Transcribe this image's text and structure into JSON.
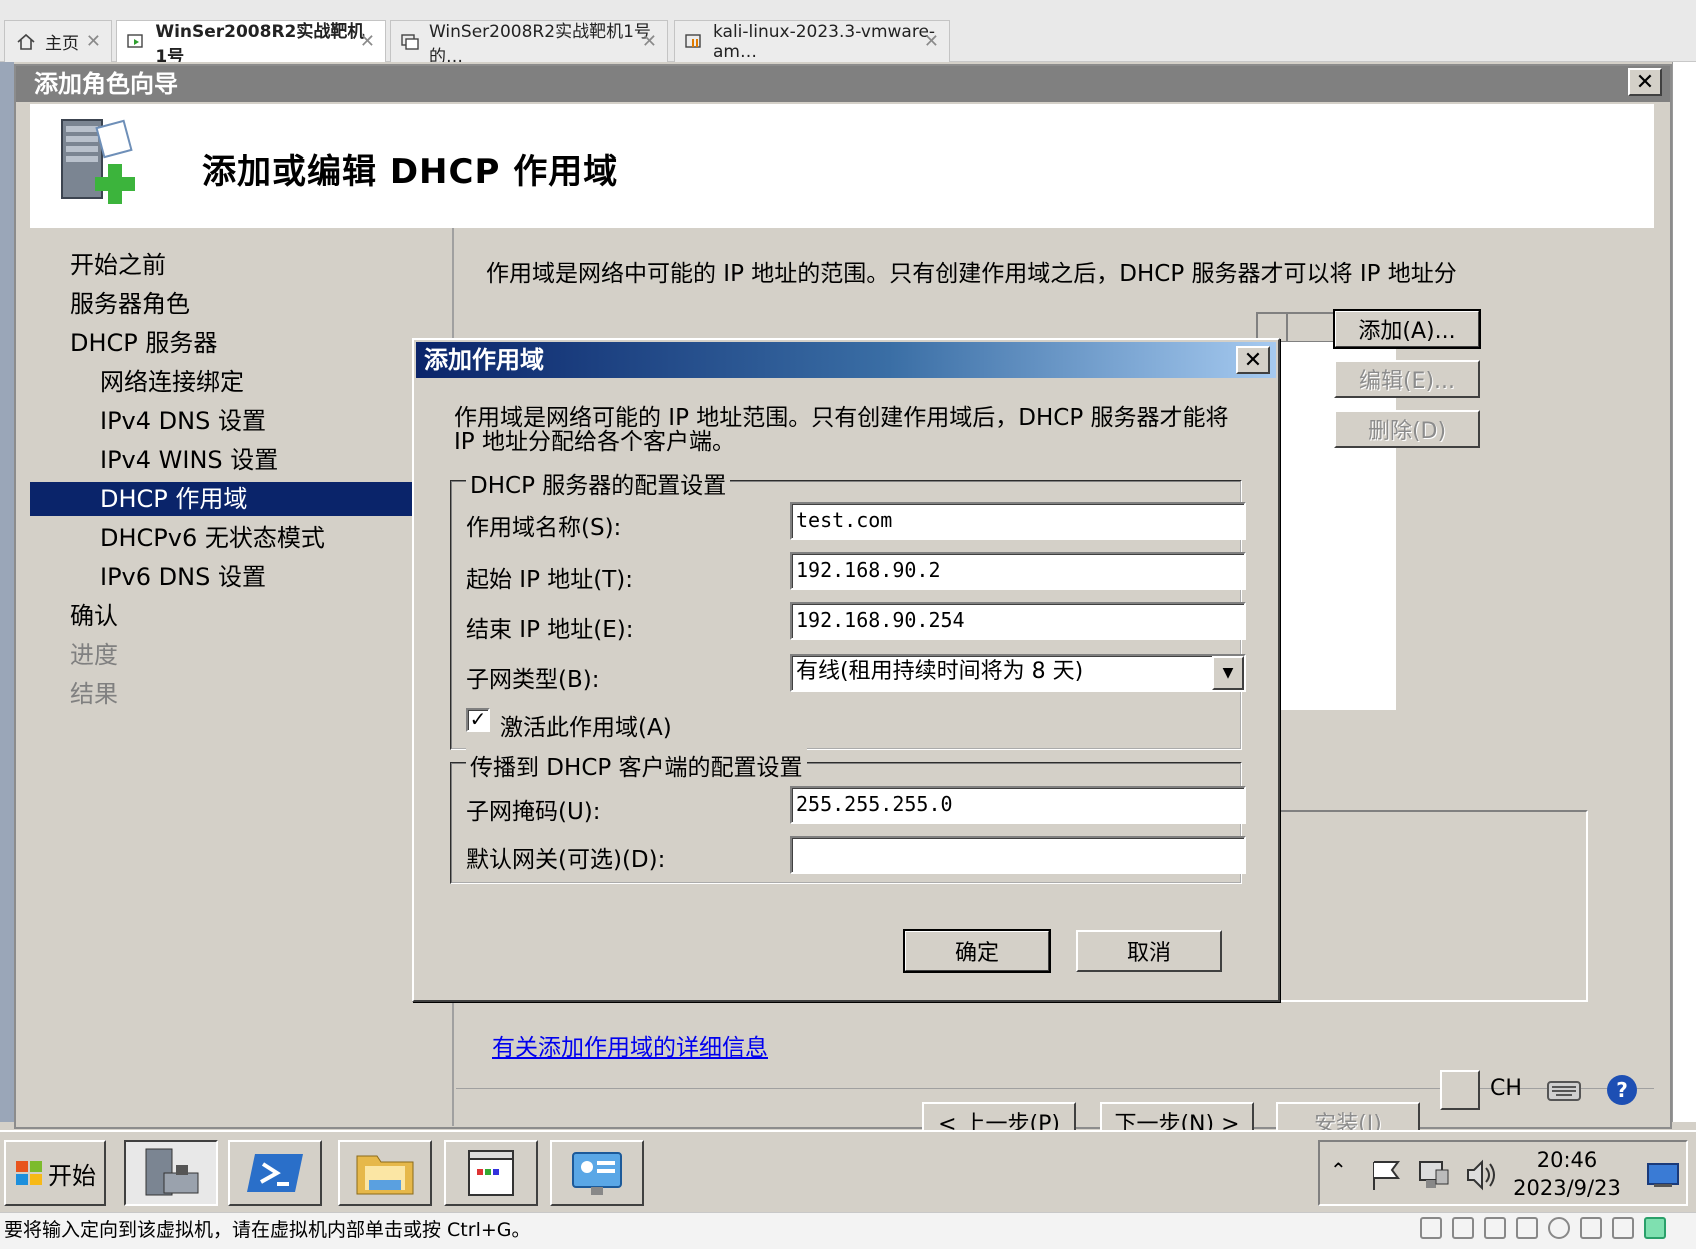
{
  "host": {
    "tabs": [
      {
        "label": "主页",
        "active": false
      },
      {
        "label": "WinSer2008R2实战靶机1号",
        "active": true
      },
      {
        "label": "WinSer2008R2实战靶机1号 的…",
        "active": false
      },
      {
        "label": "kali-linux-2023.3-vmware-am…",
        "active": false
      }
    ],
    "status_text": "要将输入定向到该虚拟机，请在虚拟机内部单击或按 Ctrl+G。"
  },
  "wizard": {
    "window_title": "添加角色向导",
    "page_title": "添加或编辑 DHCP 作用域",
    "nav": [
      {
        "label": "开始之前",
        "level": 1,
        "state": "normal"
      },
      {
        "label": "服务器角色",
        "level": 1,
        "state": "normal"
      },
      {
        "label": "DHCP 服务器",
        "level": 1,
        "state": "normal"
      },
      {
        "label": "网络连接绑定",
        "level": 2,
        "state": "normal"
      },
      {
        "label": "IPv4 DNS 设置",
        "level": 2,
        "state": "normal"
      },
      {
        "label": "IPv4 WINS 设置",
        "level": 2,
        "state": "normal"
      },
      {
        "label": "DHCP 作用域",
        "level": 2,
        "state": "selected"
      },
      {
        "label": "DHCPv6 无状态模式",
        "level": 2,
        "state": "normal"
      },
      {
        "label": "IPv6 DNS 设置",
        "level": 2,
        "state": "normal"
      },
      {
        "label": "确认",
        "level": 1,
        "state": "normal"
      },
      {
        "label": "进度",
        "level": 1,
        "state": "dim"
      },
      {
        "label": "结果",
        "level": 1,
        "state": "dim"
      }
    ],
    "description": "作用域是网络中可能的 IP 地址的范围。只有创建作用域之后，DHCP 服务器才可以将 IP 地址分",
    "add_button": "添加(A)...",
    "edit_button": "编辑(E)...",
    "delete_button": "删除(D)",
    "details_link": "有关添加作用域的详细信息",
    "prev_button": "< 上一步(P)",
    "next_button": "下一步(N) >",
    "install_button": "安装(I)"
  },
  "dialog": {
    "title": "添加作用域",
    "description": "作用域是网络可能的 IP 地址范围。只有创建作用域后，DHCP 服务器才能将 IP 地址分配给各个客户端。",
    "server_group": {
      "label": "DHCP 服务器的配置设置",
      "scope_name_label": "作用域名称(S):",
      "scope_name_value": "test.com",
      "start_ip_label": "起始 IP 地址(T):",
      "start_ip_value": "192.168.90.2",
      "end_ip_label": "结束 IP 地址(E):",
      "end_ip_value": "192.168.90.254",
      "subnet_type_label": "子网类型(B):",
      "subnet_type_value": "有线(租用持续时间将为 8 天)",
      "activate_label": "激活此作用域(A)",
      "activate_checked": true
    },
    "client_group": {
      "label": "传播到 DHCP 客户端的配置设置",
      "subnet_mask_label": "子网掩码(U):",
      "subnet_mask_value": "255.255.255.0",
      "gateway_label": "默认网关(可选)(D):",
      "gateway_value": ""
    },
    "ok_button": "确定",
    "cancel_button": "取消"
  },
  "guest_taskbar": {
    "start_label": "开始",
    "ime_label": "CH",
    "time": "20:46",
    "date": "2023/9/23"
  },
  "colors": {
    "selection": "#0a246a",
    "dialog_title_start": "#0a246a",
    "dialog_title_end": "#a6caf0",
    "link": "#0000ee",
    "classic_face": "#d4d0c8"
  }
}
